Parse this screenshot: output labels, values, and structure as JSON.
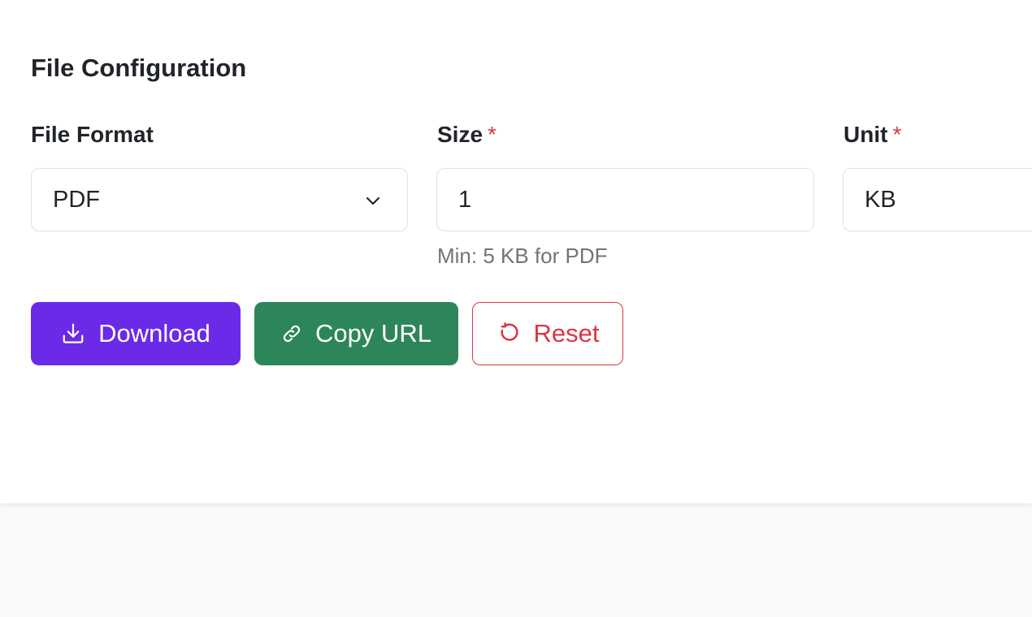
{
  "section": {
    "title": "File Configuration"
  },
  "fields": {
    "format": {
      "label": "File Format",
      "value": "PDF",
      "icon": "chevron-down-icon"
    },
    "size": {
      "label": "Size",
      "required_mark": "*",
      "value": "1",
      "help": "Min: 5 KB for PDF"
    },
    "unit": {
      "label": "Unit",
      "required_mark": "*",
      "value": "KB"
    }
  },
  "actions": {
    "download": {
      "label": "Download",
      "icon": "download-icon",
      "color": "#6a2ae8"
    },
    "copy_url": {
      "label": "Copy URL",
      "icon": "link-icon",
      "color": "#2d8659"
    },
    "reset": {
      "label": "Reset",
      "icon": "reset-icon",
      "color": "#dc3545"
    }
  }
}
